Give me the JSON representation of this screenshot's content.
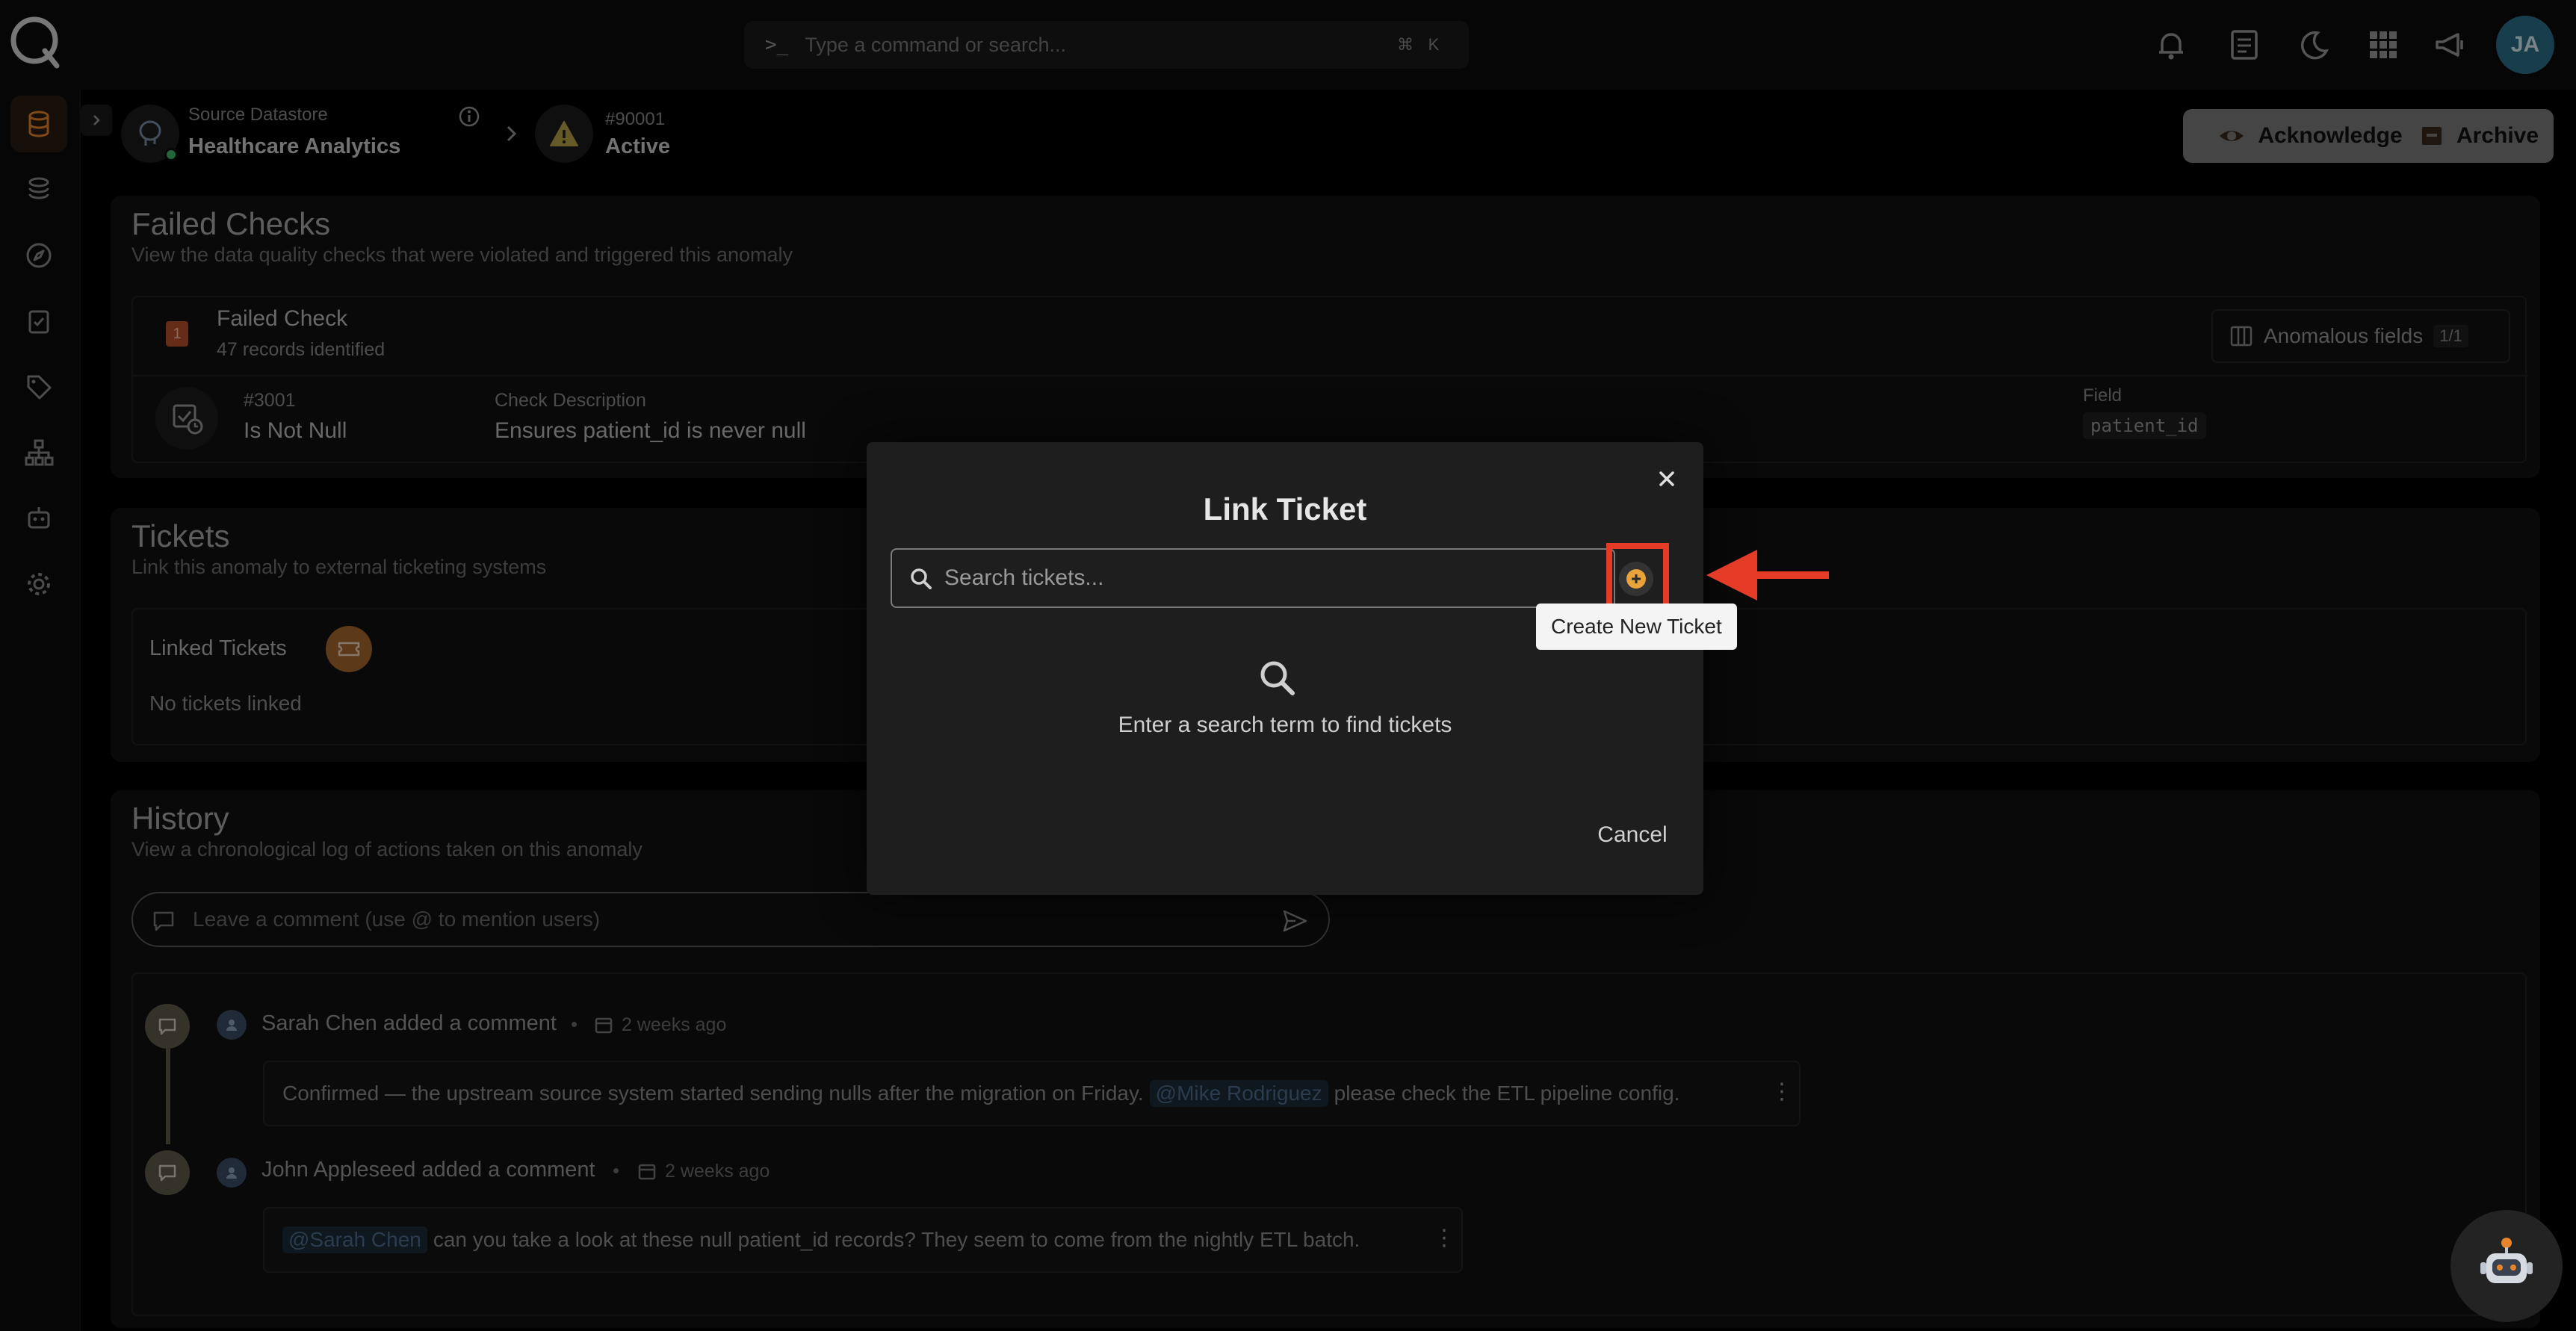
{
  "topbar": {
    "command_placeholder": "Type a command or search...",
    "shortcut_mod": "⌘",
    "shortcut_key": "K",
    "avatar_initials": "JA",
    "icons": [
      "bell-icon",
      "notes-icon",
      "moon-icon",
      "apps-grid-icon",
      "megaphone-icon"
    ]
  },
  "sidebar": {
    "items": [
      "database-icon",
      "layers-icon",
      "compass-icon",
      "checklist-icon",
      "tag-icon",
      "hierarchy-icon",
      "robot-icon",
      "gear-icon"
    ],
    "active_item": "database-icon"
  },
  "header": {
    "datastore_label": "Source Datastore",
    "datastore_name": "Healthcare Analytics",
    "anomaly_id": "#90001",
    "anomaly_status": "Active",
    "acknowledge_label": "Acknowledge",
    "archive_label": "Archive"
  },
  "failed_checks": {
    "title": "Failed Checks",
    "subtitle": "View the data quality checks that were violated and triggered this anomaly",
    "badge_count": "1",
    "group_title": "Failed Check",
    "group_sub": "47 records identified",
    "anomalous_fields_label": "Anomalous fields",
    "anomalous_fields_count": "1/1",
    "check_id": "#3001",
    "check_name": "Is Not Null",
    "description_label": "Check Description",
    "description_value": "Ensures patient_id is never null",
    "field_label": "Field",
    "field_value": "patient_id"
  },
  "tickets": {
    "title": "Tickets",
    "subtitle": "Link this anomaly to external ticketing systems",
    "linked_label": "Linked Tickets",
    "empty_label": "No tickets linked"
  },
  "history": {
    "title": "History",
    "subtitle": "View a chronological log of actions taken on this anomaly",
    "comment_placeholder": "Leave a comment (use @ to mention users)",
    "entries": [
      {
        "author_action": "Sarah Chen added a comment",
        "time": "2 weeks ago",
        "text_before": "Confirmed — the upstream source system started sending nulls after the migration on Friday.",
        "mention": "@Mike Rodriguez",
        "text_after": "please check the ETL pipeline config."
      },
      {
        "author_action": "John Appleseed added a comment",
        "time": "2 weeks ago",
        "mention": "@Sarah Chen",
        "text_after": "can you take a look at these null patient_id records? They seem to come from the nightly ETL batch."
      }
    ]
  },
  "modal": {
    "title": "Link Ticket",
    "search_placeholder": "Search tickets...",
    "create_tooltip": "Create New Ticket",
    "empty_message": "Enter a search term to find tickets",
    "cancel_label": "Cancel"
  },
  "colors": {
    "accent_orange": "#e8852c",
    "annotation_red": "#e53b27",
    "avatar_teal": "#2d6f88"
  }
}
